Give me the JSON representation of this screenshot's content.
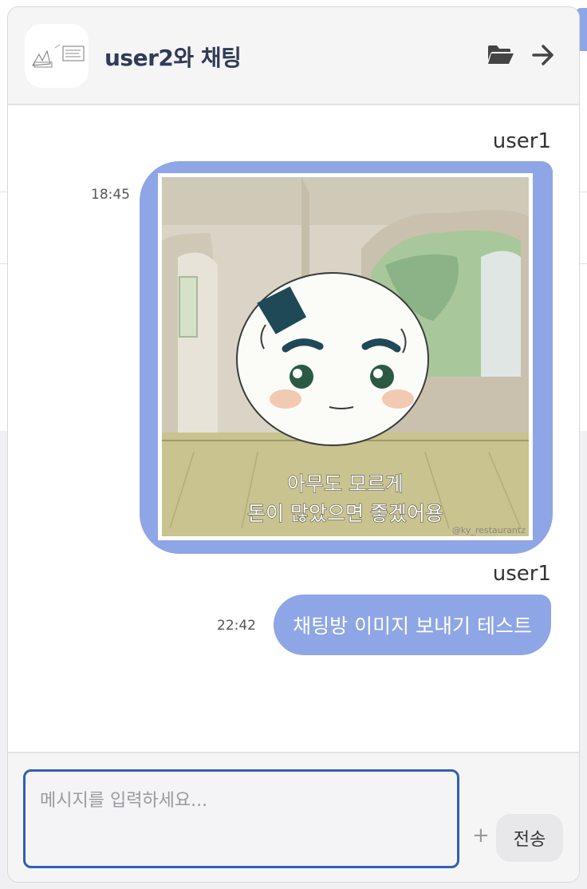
{
  "header": {
    "title": "user2와 채팅",
    "avatar_icon": "profile-thumbnail",
    "folder_icon": "folder-open-icon",
    "exit_icon": "arrow-right-icon"
  },
  "messages": [
    {
      "sender": "user1",
      "time": "18:45",
      "type": "image",
      "image_caption_line1": "아무도 모르게",
      "image_caption_line2": "돈이 많았으면 좋겠어용",
      "image_watermark": "@ky_restaurantz"
    },
    {
      "sender": "user1",
      "time": "22:42",
      "type": "text",
      "text": "채팅방 이미지 보내기 테스트"
    }
  ],
  "composer": {
    "placeholder": "메시지를 입력하세요...",
    "value": "",
    "plus_label": "+",
    "send_label": "전송"
  },
  "colors": {
    "bubble": "#8ea6e6",
    "title": "#2f3b57",
    "input_border": "#2f5fb8"
  }
}
